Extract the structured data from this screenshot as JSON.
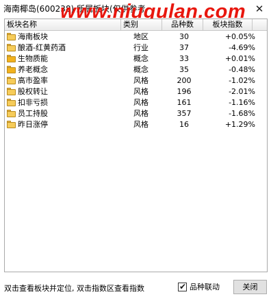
{
  "window": {
    "title": "海南椰岛(600238) 所属板块(仅供参考",
    "watermark": "www.niugulan.com",
    "close_glyph": "✕"
  },
  "table": {
    "columns": [
      "板块名称",
      "类别",
      "品种数",
      "板块指数"
    ],
    "rows": [
      {
        "name": "海南板块",
        "category": "地区",
        "count": "30",
        "index": "+0.05%",
        "icon": "folder-icon"
      },
      {
        "name": "酿酒-红黄药酒",
        "category": "行业",
        "count": "37",
        "index": "-4.69%",
        "icon": "folder-icon"
      },
      {
        "name": "生物质能",
        "category": "概念",
        "count": "33",
        "index": "+0.01%",
        "icon": "folder-filled-icon"
      },
      {
        "name": "养老概念",
        "category": "概念",
        "count": "35",
        "index": "-0.48%",
        "icon": "folder-filled-icon"
      },
      {
        "name": "高市盈率",
        "category": "风格",
        "count": "200",
        "index": "-1.02%",
        "icon": "folder-icon"
      },
      {
        "name": "股权转让",
        "category": "风格",
        "count": "196",
        "index": "-2.01%",
        "icon": "folder-icon"
      },
      {
        "name": "扣非亏损",
        "category": "风格",
        "count": "161",
        "index": "-1.16%",
        "icon": "folder-icon"
      },
      {
        "name": "员工持股",
        "category": "风格",
        "count": "357",
        "index": "-1.68%",
        "icon": "folder-icon"
      },
      {
        "name": "昨日涨停",
        "category": "风格",
        "count": "16",
        "index": "+1.29%",
        "icon": "folder-icon"
      }
    ]
  },
  "footer": {
    "hint": "双击查看板块并定位, 双击指数区查看指数",
    "checkbox_label": "品种联动",
    "checkbox_checked": true,
    "checkmark_glyph": "✔",
    "close_label": "关闭"
  },
  "colors": {
    "watermark": "#e8170e",
    "folder": "#f6cc5a"
  }
}
